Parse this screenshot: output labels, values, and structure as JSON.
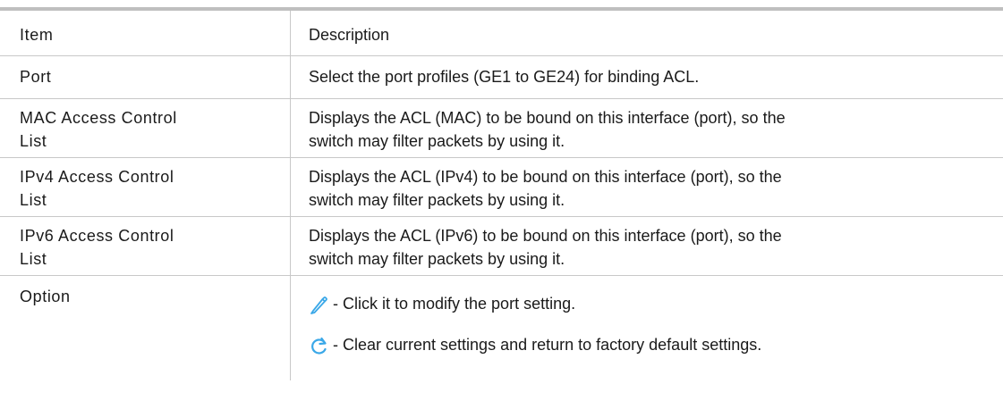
{
  "table": {
    "header": {
      "item": "Item",
      "description": "Description"
    },
    "rows": [
      {
        "item": "Port",
        "description": "Select the port profiles (GE1 to GE24) for binding ACL."
      },
      {
        "item_lines": [
          "MAC Access Control",
          "List"
        ],
        "description_lines": [
          "Displays the ACL (MAC) to be bound on this interface (port), so the",
          "switch may filter packets by using it."
        ]
      },
      {
        "item_lines": [
          "IPv4 Access Control",
          "List"
        ],
        "description_lines": [
          "Displays the ACL (IPv4) to be bound on this interface (port), so the",
          "switch may filter packets by using it."
        ]
      },
      {
        "item_lines": [
          "IPv6 Access Control",
          "List"
        ],
        "description_lines": [
          "Displays the ACL (IPv6) to be bound on this interface (port), so the",
          "switch may filter packets by using it."
        ]
      }
    ],
    "option": {
      "item": "Option",
      "entries": [
        {
          "icon": "pencil-edit-icon",
          "text": " - Click it to modify the port setting."
        },
        {
          "icon": "refresh-icon",
          "text": " - Clear current settings and return to factory default settings."
        }
      ]
    }
  },
  "colors": {
    "icon_blue": "#3aa8e8",
    "rule": "#c8c8c8",
    "top_bar": "#bfbfbf"
  }
}
